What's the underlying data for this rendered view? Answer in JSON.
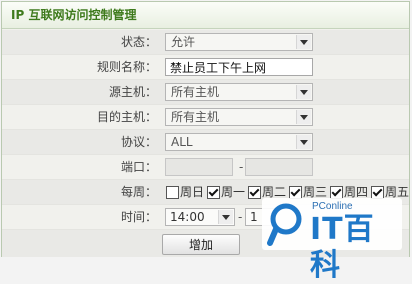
{
  "title": "IP 互联网访问控制管理",
  "form": {
    "status": {
      "label": "状态：",
      "value": "允许"
    },
    "rule_name": {
      "label": "规则名称：",
      "value": "禁止员工下午上网"
    },
    "source_host": {
      "label": "源主机：",
      "value": "所有主机"
    },
    "dest_host": {
      "label": "目的主机：",
      "value": "所有主机"
    },
    "protocol": {
      "label": "协议：",
      "value": "ALL"
    },
    "port": {
      "label": "端口：",
      "separator": "-"
    },
    "weekly": {
      "label": "每周：",
      "days": [
        {
          "label": "周日",
          "checked": false
        },
        {
          "label": "周一",
          "checked": true
        },
        {
          "label": "周二",
          "checked": true
        },
        {
          "label": "周三",
          "checked": true
        },
        {
          "label": "周四",
          "checked": true
        },
        {
          "label": "周五",
          "checked": true
        }
      ]
    },
    "time": {
      "label": "时间：",
      "start": "14:00",
      "separator": "-",
      "end": "1"
    }
  },
  "add_button": "增加",
  "watermark": {
    "brand": "PConline",
    "name": "IT百科"
  },
  "colors": {
    "title_text": "#3e7a1c",
    "border": "#b9c9b0",
    "watermark": "#1f78c8"
  }
}
